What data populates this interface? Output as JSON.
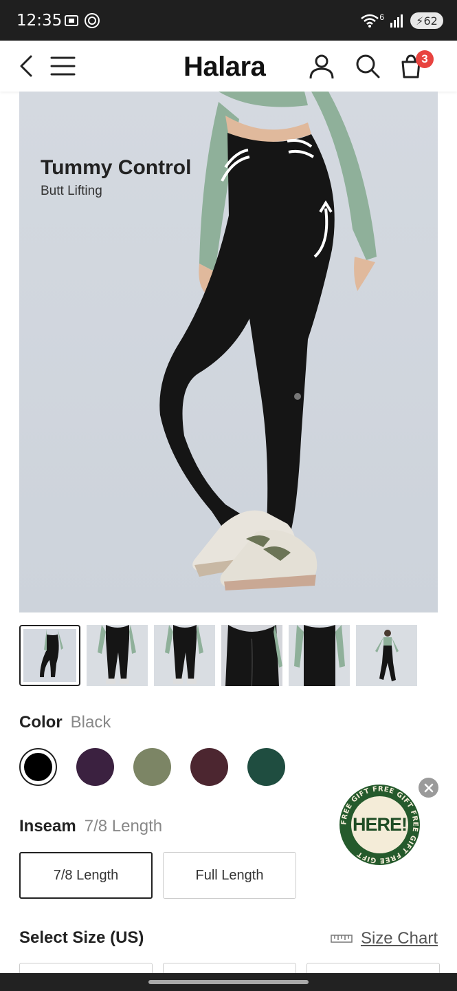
{
  "status_bar": {
    "time": "12:35",
    "battery": "62",
    "network_label": "6"
  },
  "header": {
    "logo": "Halara",
    "cart_count": "3"
  },
  "hero": {
    "title": "Tummy Control",
    "subtitle": "Butt Lifting"
  },
  "thumbnails_count": 6,
  "color": {
    "label": "Color",
    "selected": "Black",
    "swatches": [
      "#000000",
      "#3b2140",
      "#7c8565",
      "#4c2630",
      "#1f4d40"
    ]
  },
  "inseam": {
    "label": "Inseam",
    "selected": "7/8 Length",
    "options": [
      "7/8 Length",
      "Full Length"
    ]
  },
  "size": {
    "label": "Select Size (US)",
    "chart_link": "Size Chart"
  },
  "promo": {
    "center_text": "HERE!",
    "ring_text": "FREE GIFT FREE GIFT FREE GIFT FREE GIFT"
  },
  "colors": {
    "badge": "#e8433f",
    "promo_green": "#255a2c"
  }
}
